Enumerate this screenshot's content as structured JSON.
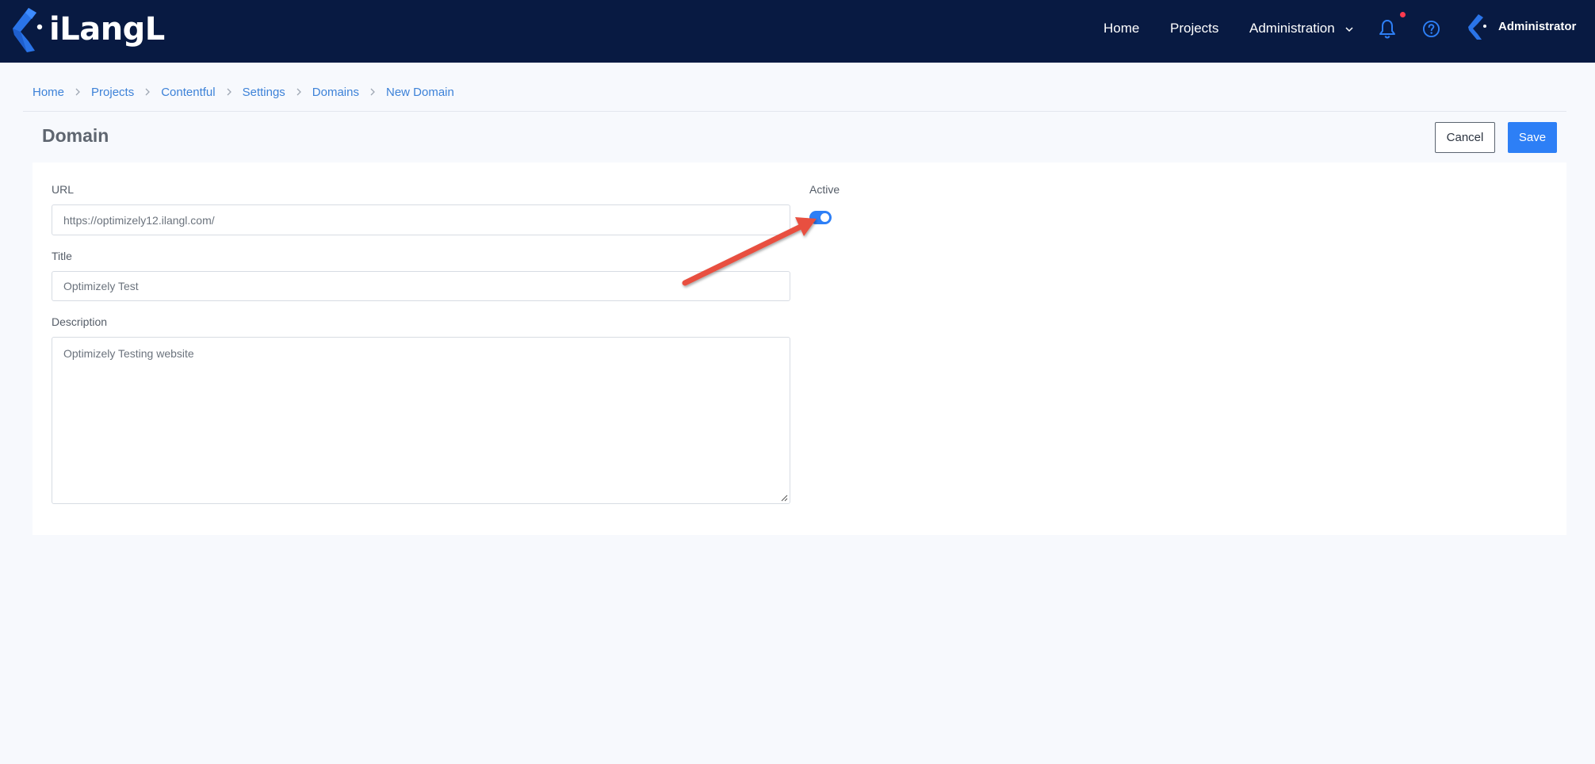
{
  "navbar": {
    "logo_text": "iLangL",
    "home": "Home",
    "projects": "Projects",
    "administration": "Administration",
    "user_name": "Administrator"
  },
  "breadcrumb": [
    "Home",
    "Projects",
    "Contentful",
    "Settings",
    "Domains",
    "New Domain"
  ],
  "page": {
    "title": "Domain",
    "cancel_label": "Cancel",
    "save_label": "Save"
  },
  "form": {
    "url_label": "URL",
    "url_value": "https://optimizely12.ilangl.com/",
    "title_label": "Title",
    "title_value": "Optimizely Test",
    "description_label": "Description",
    "description_value": "Optimizely Testing website",
    "active_label": "Active",
    "active": true
  },
  "colors": {
    "navbar": "#081a42",
    "accent": "#2d7ff6",
    "link": "#3d82d8",
    "notification_dot": "#ff3a4f",
    "annotation_arrow": "#e8503f"
  },
  "icons": {
    "logo": "ilangl-logo-icon",
    "chevron": "chevron-down-icon",
    "bell": "bell-icon",
    "help": "help-circle-icon",
    "avatar": "user-avatar-icon",
    "breadcrumb_separator": "chevron-right-icon"
  }
}
